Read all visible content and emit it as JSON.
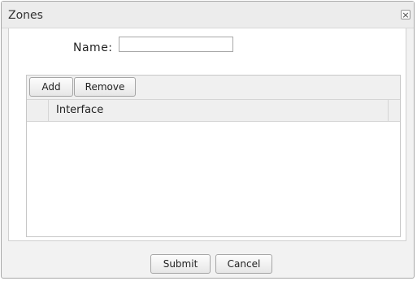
{
  "dialog": {
    "title": "Zones",
    "close_glyph": "×"
  },
  "form": {
    "name_label": "Name:",
    "name_value": "",
    "name_placeholder": ""
  },
  "toolbar": {
    "add_label": "Add",
    "remove_label": "Remove"
  },
  "grid": {
    "columns": [
      "Interface"
    ],
    "rows": []
  },
  "footer": {
    "submit_label": "Submit",
    "cancel_label": "Cancel"
  }
}
